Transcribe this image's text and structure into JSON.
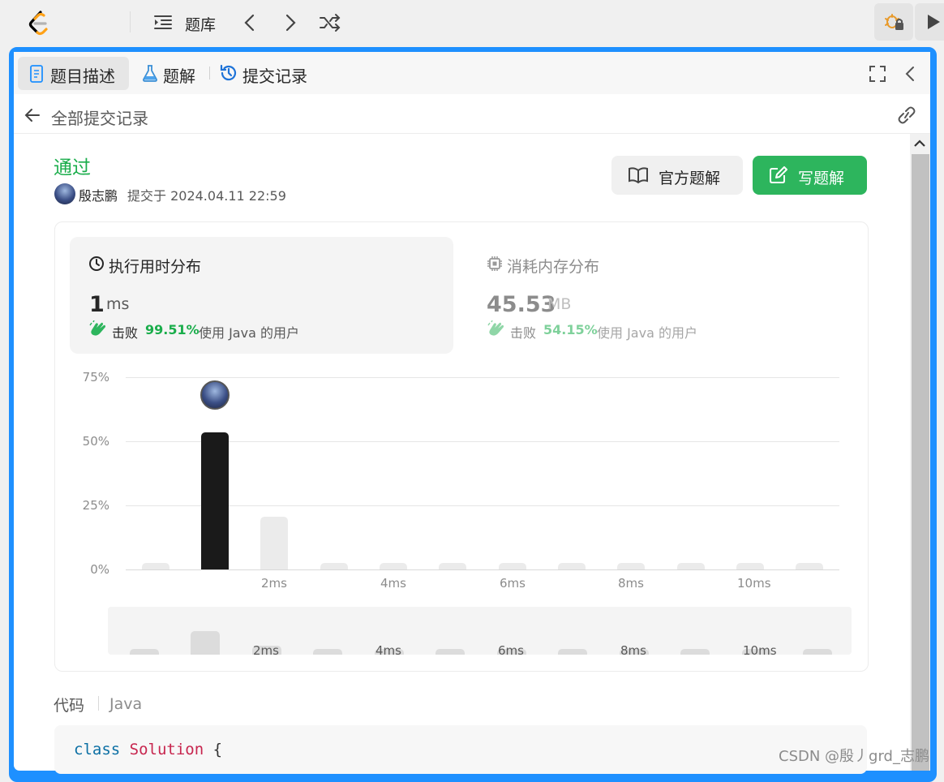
{
  "topbar": {
    "problems_label": "题库",
    "icons": [
      "leetcode-logo",
      "list-icon",
      "chevron-left-icon",
      "chevron-right-icon",
      "shuffle-icon",
      "debug-icon",
      "run-icon"
    ]
  },
  "tabs": [
    {
      "label": "题目描述",
      "icon": "document-icon",
      "active": true
    },
    {
      "label": "题解",
      "icon": "flask-icon",
      "active": false
    },
    {
      "label": "提交记录",
      "icon": "history-icon",
      "active": false
    }
  ],
  "subheader": {
    "back_label": "全部提交记录"
  },
  "submission": {
    "status": "通过",
    "status_color": "#1aad4b",
    "user": "殷志鹏",
    "submitted_at": "提交于 2024.04.11 22:59",
    "official_solution_label": "官方题解",
    "write_solution_label": "写题解"
  },
  "runtime": {
    "title": "执行用时分布",
    "value": "1",
    "unit": "ms",
    "beats_prefix": "击败",
    "beats_percent": "99.51%",
    "beats_suffix": "使用 Java 的用户"
  },
  "memory": {
    "title": "消耗内存分布",
    "value": "45.53",
    "unit": "MB",
    "beats_prefix": "击败",
    "beats_percent": "54.15%",
    "beats_suffix": "使用 Java 的用户"
  },
  "chart_data": {
    "type": "bar",
    "categories": [
      "0ms",
      "1ms",
      "2ms",
      "3ms",
      "4ms",
      "5ms",
      "6ms",
      "7ms",
      "8ms",
      "9ms",
      "10ms",
      "11ms"
    ],
    "values": [
      0.3,
      53.5,
      20.5,
      0.3,
      0.3,
      0.3,
      0.3,
      0.3,
      0.3,
      0.3,
      0.3,
      0.3
    ],
    "highlight_index": 1,
    "yticks": [
      "75%",
      "50%",
      "25%",
      "0%"
    ],
    "ytick_values": [
      75,
      50,
      25,
      0
    ],
    "xticks": [
      "2ms",
      "4ms",
      "6ms",
      "8ms",
      "10ms"
    ],
    "xtick_indices": [
      2,
      4,
      6,
      8,
      10
    ],
    "ylim": [
      0,
      75
    ],
    "grid": true,
    "highlight_color": "#1a1a1a",
    "bar_color": "#ebebeb",
    "navigator_bar_color": "#dcdcdc"
  },
  "code": {
    "label": "代码",
    "language": "Java",
    "line1": {
      "keyword": "class",
      "name": "Solution",
      "brace": "{"
    }
  },
  "watermark": "CSDN @殷丿grd_志鹏"
}
